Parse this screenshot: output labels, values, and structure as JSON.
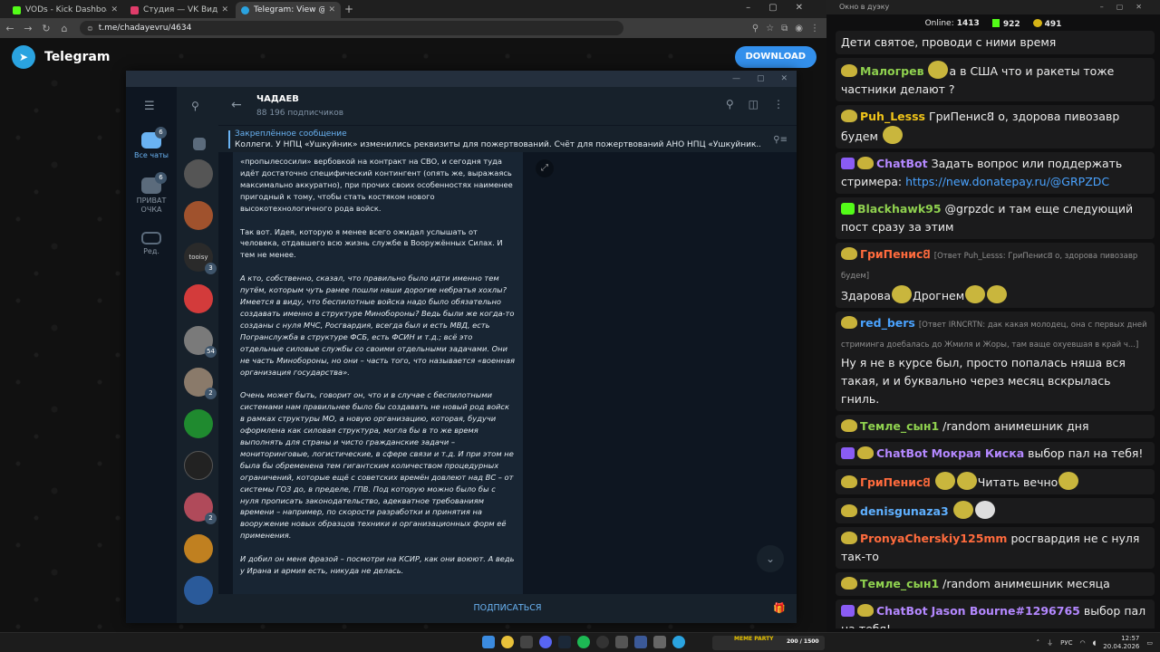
{
  "browser": {
    "tabs": [
      {
        "label": "VODs - Kick Dashboard",
        "color": "#53fc18",
        "active": false
      },
      {
        "label": "Студия — VK Видео Live",
        "color": "#e03c6a",
        "active": false
      },
      {
        "label": "Telegram: View @chadayevru",
        "color": "#2aa3e0",
        "active": true
      }
    ],
    "url": "t.me/chadayevru/4634"
  },
  "telegram_web": {
    "title": "Telegram",
    "download_label": "DOWNLOAD"
  },
  "tg_app": {
    "rail": [
      {
        "label": "Все чаты",
        "badge": "6",
        "active": true
      },
      {
        "label": "ПРИВАТ ОЧКА",
        "badge": "6",
        "active": false
      },
      {
        "label": "Ред.",
        "badge": "",
        "active": false
      }
    ],
    "chat_avatars": [
      {
        "color": "#555555",
        "badge": ""
      },
      {
        "color": "#a0522d",
        "badge": ""
      },
      {
        "color": "#2a2a2a",
        "badge": "3",
        "text": "tooisy"
      },
      {
        "color": "#d33b3b",
        "badge": ""
      },
      {
        "color": "#7a7a7a",
        "badge": "54"
      },
      {
        "color": "#8a7a6a",
        "badge": "2"
      },
      {
        "color": "#1f8a2f",
        "badge": ""
      },
      {
        "color": "#222222",
        "badge": ""
      },
      {
        "color": "#b04a5a",
        "badge": "2"
      },
      {
        "color": "#c08020",
        "badge": ""
      },
      {
        "color": "#2a5a9a",
        "badge": ""
      }
    ],
    "channel_name": "ЧАДАЕВ",
    "subscribers": "88 196 подписчиков",
    "pinned_title": "Закреплённое сообщение",
    "pinned_text": "Коллеги. У НПЦ «Ушкуйник» изменились реквизиты для пожертвований. Счёт для пожертвований АНО НПЦ «Ушкуйник...",
    "message_paragraphs": [
      {
        "text": "«пропылесосили» вербовкой на контракт на СВО, и сегодня туда идёт достаточно специфический контингент (опять же, выражаясь максимально аккуратно), при прочих своих особенностях наименее пригодный к тому, чтобы стать костяком нового высокотехнологичного рода войск.",
        "italic": false
      },
      {
        "text": "Так вот. Идея, которую я менее всего ожидал услышать от человека, отдавшего всю жизнь службе в Вооружённых Силах. И тем не менее.",
        "italic": false
      },
      {
        "text": "А кто, собственно, сказал, что правильно было идти именно тем путём, которым чуть ранее пошли наши дорогие небратья хохлы? Имеется в виду, что беспилотные войска надо было обязательно создавать именно в структуре Минобороны? Ведь были же когда-то созданы с нуля МЧС, Росгвардия, всегда был и есть МВД, есть Погранслужба в структуре ФСБ, есть ФСИН и т.д.; всё это отдельные силовые службы со своими отдельными задачами. Они не часть Минобороны, но они – часть того, что называется «военная организация государства».",
        "italic": true
      },
      {
        "text": "Очень может быть, говорит он, что и в случае с беспилотными системами нам правильнее было бы создавать не новый род войск в рамках структуры МО, а новую организацию, которая, будучи оформлена как силовая структура, могла бы в то же время выполнять для страны и чисто гражданские задачи – мониторинговые, логистические, в сфере связи и т.д. И при этом не была бы обременена тем гигантским количеством процедурных ограничений, которые ещё с советских времён довлеют над ВС – от системы ГОЗ до, в пределе, ГПВ. Под которую можно было бы с нуля прописать законодательство, адекватное требованиям времени – например, по скорости разработки и принятия на вооружение новых образцов техники и организационных форм её применения.",
        "italic": true
      },
      {
        "text": "И добил он меня фразой – посмотри на КСИР, как они воюют. А ведь у Ирана и армия есть, никуда не делась.",
        "italic": true
      }
    ],
    "subscribe_label": "ПОДПИСАТЬСЯ"
  },
  "stream_chat": {
    "window_title": "Окно в дуэку",
    "online_label": "Online:",
    "online_count": "1413",
    "kick_count": "922",
    "other_count": "491",
    "messages": [
      {
        "user": "",
        "user_color": "#ffffff",
        "badge": "",
        "reply": "",
        "text": "Дети святое, проводи с ними время",
        "emotes_after": 0
      },
      {
        "user": "Малогрев",
        "user_color": "#8fd14f",
        "badge": "pepe",
        "reply": "",
        "text": "а в США  что и ракеты тоже частники делают ?",
        "emotes_before": 1
      },
      {
        "user": "Puh_Lesss",
        "user_color": "#f0c419",
        "badge": "pepe",
        "reply": "",
        "text": "ГриПенис𐐒 о, здорова пивозавр будем",
        "mention_color": "#f0c419"
      },
      {
        "user": "ChatBot",
        "user_color": "#b488ff",
        "badge": "bot",
        "reply": "",
        "text": "Задать вопрос или поддержать стримера: ",
        "link": "https://new.donatepay.ru/@GRPZDC"
      },
      {
        "user": "Blackhawk95",
        "user_color": "#53fc18",
        "badge": "kick",
        "reply": "",
        "text": "@grpzdc и там еще следующий пост сразу за этим",
        "mention": "@grpzdc"
      },
      {
        "user": "ГриПенис𐐒",
        "user_color": "#ff6b3d",
        "badge": "pepe",
        "reply": "[Ответ Puh_Lesss: ГриПенис𐐒 о, здорова пивозавр  будем]",
        "text": "Здарова",
        "text2": "Дрогнем"
      },
      {
        "user": "red_bers",
        "user_color": "#4aa3ff",
        "badge": "pepe",
        "reply": "[Ответ IRNCRTN: дак какая молодец, она с первых дней стриминга доебалась до Жмиля и Жоры, там ваще охуевшая в край ч...]",
        "text": "Ну я не в курсе был, просто попалась няша вся такая, и и буквально через месяц вскрылась гниль."
      },
      {
        "user": "Темле_сын1",
        "user_color": "#8fd14f",
        "badge": "pepe",
        "reply": "",
        "text": "/random анимешник дня"
      },
      {
        "user": "ChatBot",
        "user_color": "#b488ff",
        "badge": "bot",
        "reply": "",
        "text": "выбор пал на тебя!",
        "mention": "Мокрая Киска",
        "mention_color": "#b488ff"
      },
      {
        "user": "ГриПенис𐐒",
        "user_color": "#ff6b3d",
        "badge": "pepe",
        "reply": "",
        "text": "Читать вечно"
      },
      {
        "user": "denisgunaza3",
        "user_color": "#5fb0ff",
        "badge": "pepe",
        "reply": "",
        "text": ""
      },
      {
        "user": "PronyaCherskiy125mm",
        "user_color": "#ff6b3d",
        "badge": "pepe",
        "reply": "",
        "text": "росгвардия не с нуля так-то"
      },
      {
        "user": "Темле_сын1",
        "user_color": "#8fd14f",
        "badge": "pepe",
        "reply": "",
        "text": "/random анимешник месяца"
      },
      {
        "user": "ChatBot",
        "user_color": "#b488ff",
        "badge": "bot",
        "reply": "",
        "text": "выбор пал на тебя!",
        "mention": "Jason Bourne#1296765",
        "mention_color": "#b488ff"
      }
    ]
  },
  "taskbar": {
    "overlay_title": "MEME PARTY",
    "overlay_count": "200 / 1500",
    "lang": "РУС",
    "time": "12:57",
    "date": "20.04.2026"
  }
}
